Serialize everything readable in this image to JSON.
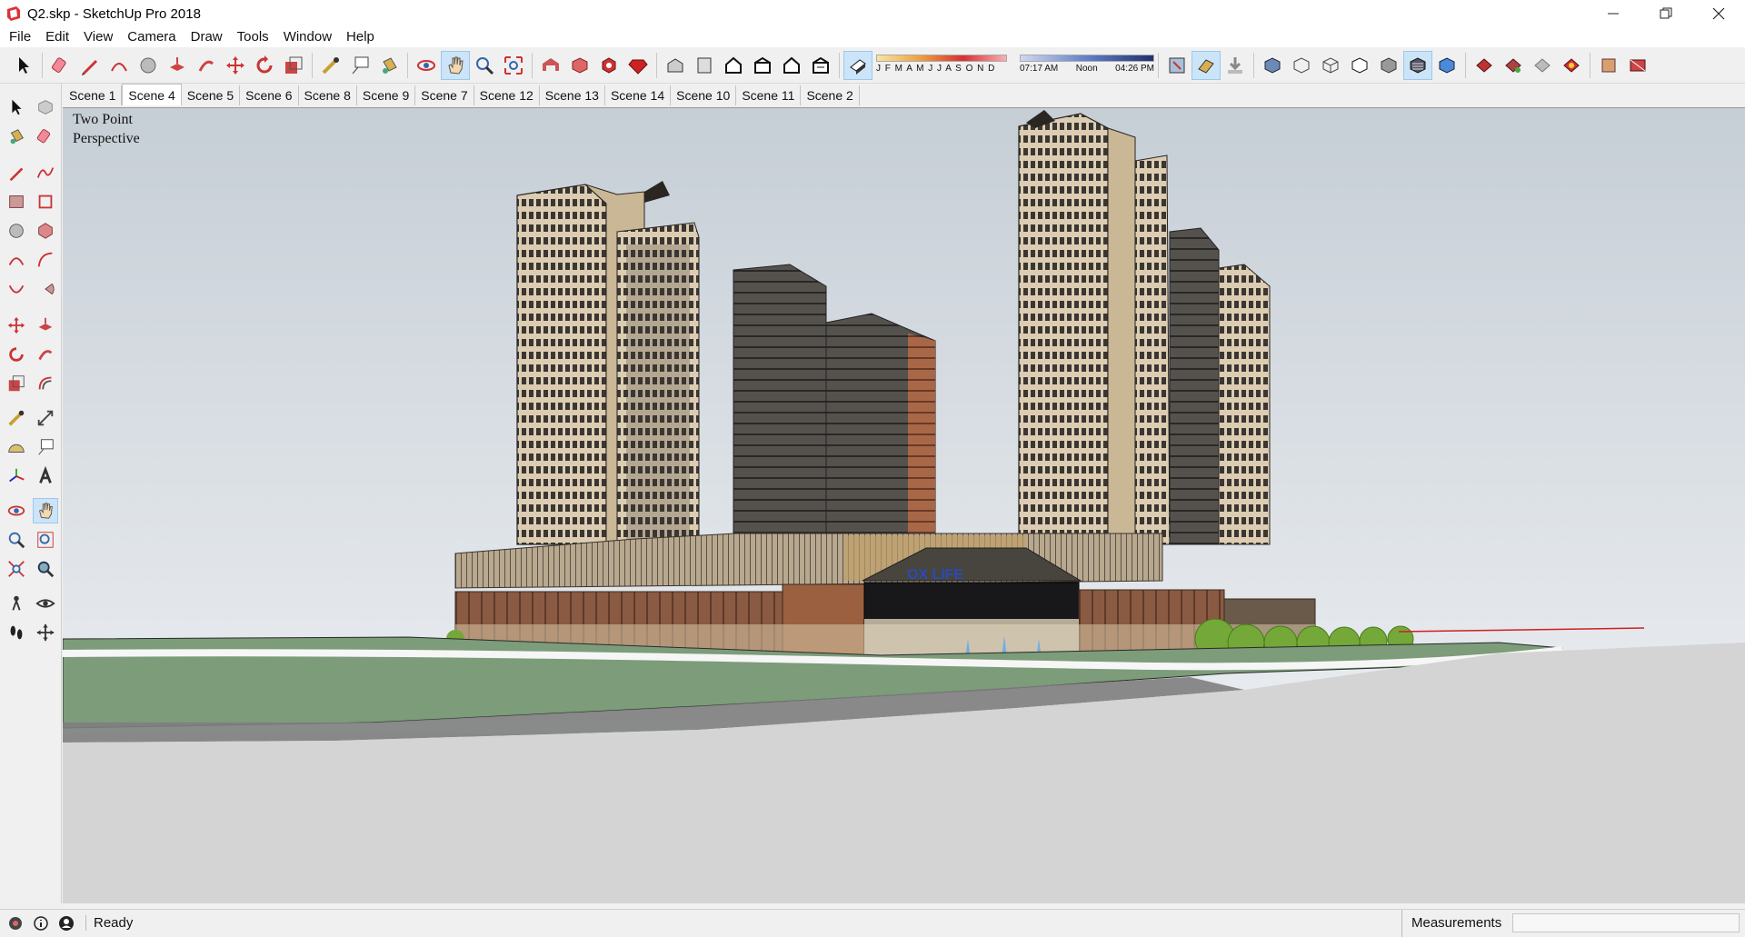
{
  "window": {
    "title": "Q2.skp - SketchUp Pro 2018",
    "controls": [
      "minimize-icon",
      "restore-icon",
      "close-icon"
    ]
  },
  "menu": [
    "File",
    "Edit",
    "View",
    "Camera",
    "Draw",
    "Tools",
    "Window",
    "Help"
  ],
  "shadows": {
    "months": "J F M A M J J A S O N D",
    "time_start": "07:17 AM",
    "time_mid": "Noon",
    "time_end": "04:26 PM"
  },
  "scenes": {
    "tabs": [
      "Scene 1",
      "Scene 4",
      "Scene 5",
      "Scene 6",
      "Scene 8",
      "Scene 9",
      "Scene 7",
      "Scene 12",
      "Scene 13",
      "Scene 14",
      "Scene 10",
      "Scene 11",
      "Scene 2"
    ],
    "active": "Scene 4"
  },
  "viewport": {
    "camera_line1": "Two Point",
    "camera_line2": "Perspective",
    "sign_text": "OX LIFE"
  },
  "status": {
    "text": "Ready",
    "measurements_label": "Measurements",
    "measurements_value": ""
  },
  "colors": {
    "accent_active": "#cce4f7",
    "sky_top": "#c8d0d8",
    "sky_bottom": "#e8ecef",
    "lawn": "#7a9a78",
    "tower_light": "#d9c9b0",
    "tower_dark": "#5a5550",
    "podium_brick": "#8a5a40"
  }
}
